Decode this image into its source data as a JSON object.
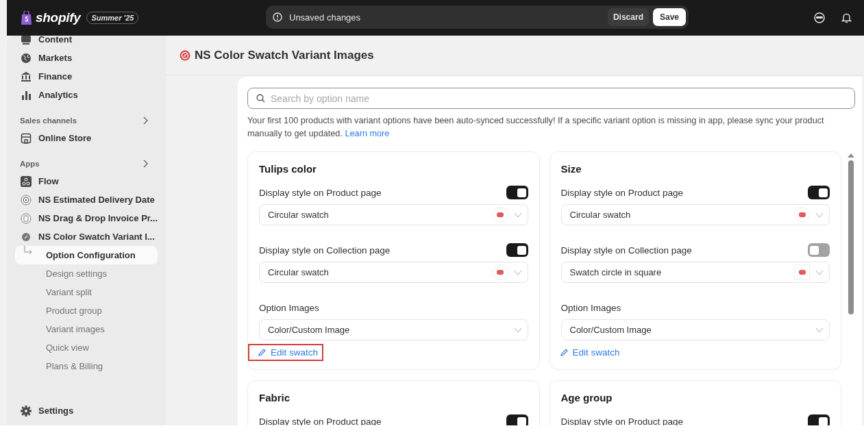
{
  "topbar": {
    "brand": "shopify",
    "edition": "Summer '25",
    "notice": "Unsaved changes",
    "discard": "Discard",
    "save": "Save"
  },
  "sidebar": {
    "top_items": [
      {
        "label": "Content"
      },
      {
        "label": "Markets"
      },
      {
        "label": "Finance"
      },
      {
        "label": "Analytics"
      }
    ],
    "sections": [
      {
        "heading": "Sales channels",
        "items": [
          {
            "label": "Online Store"
          }
        ]
      },
      {
        "heading": "Apps",
        "items": [
          {
            "label": "Flow"
          },
          {
            "label": "NS Estimated Delivery Date"
          },
          {
            "label": "NS Drag & Drop Invoice Pr..."
          },
          {
            "label": "NS Color Swatch Variant I...",
            "children": [
              {
                "label": "Option Configuration",
                "selected": true
              },
              {
                "label": "Design settings",
                "selected": false
              },
              {
                "label": "Variant split",
                "selected": false
              },
              {
                "label": "Product group",
                "selected": false
              },
              {
                "label": "Variant images",
                "selected": false
              },
              {
                "label": "Quick view",
                "selected": false
              },
              {
                "label": "Plans & Billing",
                "selected": false
              }
            ]
          }
        ]
      }
    ],
    "settings": "Settings"
  },
  "page": {
    "title": "NS Color Swatch Variant Images",
    "search": {
      "placeholder": "Search by option name"
    },
    "notice": "Your first 100 products with variant options have been auto-synced successfully! If a specific variant option is missing in app, please sync your product manually to get updated.",
    "notice_link": "Learn more",
    "cards": [
      {
        "title": "Tulips color",
        "highlighted": true,
        "edit_link": "Edit swatch",
        "settings": [
          {
            "kind": "circle",
            "label": "Display style on Product page",
            "on": true,
            "value": "Circular swatch"
          },
          {
            "kind": "circle",
            "label": "Display style on Collection page",
            "on": true,
            "value": "Circular swatch"
          },
          {
            "kind": "select",
            "label": "Option Images",
            "value": "Color/Custom Image"
          }
        ]
      },
      {
        "title": "Size",
        "highlighted": false,
        "edit_link": "Edit swatch",
        "settings": [
          {
            "kind": "circle",
            "label": "Display style on Product page",
            "on": true,
            "value": "Circular swatch"
          },
          {
            "kind": "square",
            "label": "Display style on Collection page",
            "on": false,
            "value": "Swatch circle in square"
          },
          {
            "kind": "select",
            "label": "Option Images",
            "value": "Color/Custom Image"
          }
        ]
      },
      {
        "title": "Fabric",
        "settings": [
          {
            "kind": "toggle",
            "label": "Display style on Product page",
            "on": true
          }
        ]
      },
      {
        "title": "Age group",
        "settings": [
          {
            "kind": "toggle",
            "label": "Display style on Product page",
            "on": true
          }
        ]
      }
    ]
  }
}
